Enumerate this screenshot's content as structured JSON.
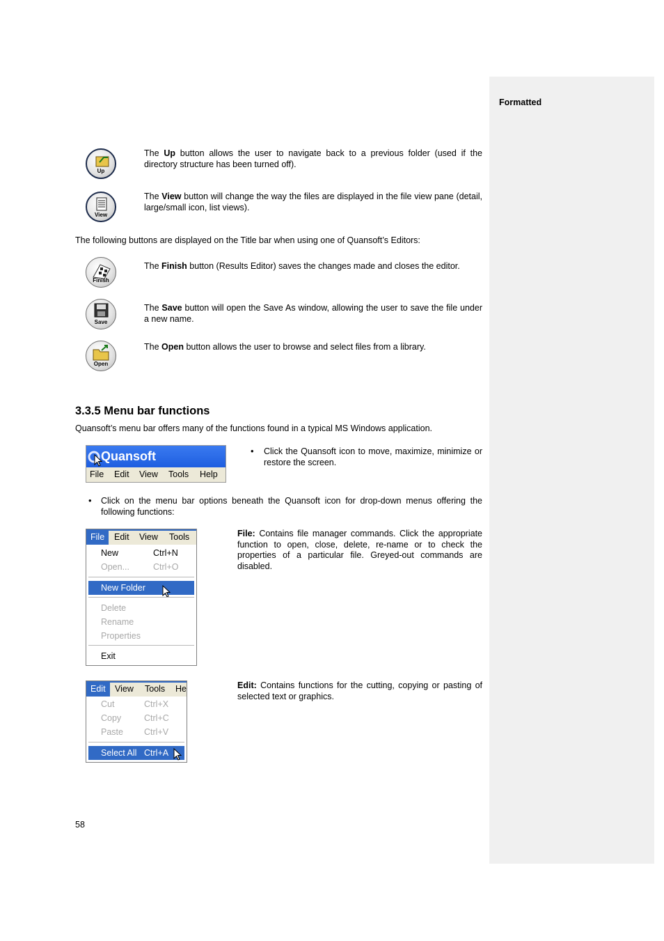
{
  "comment_pane": {
    "label": "Formatted"
  },
  "icons": {
    "up": "Up",
    "view": "View",
    "finish": "Finish",
    "save": "Save",
    "open": "Open"
  },
  "paragraphs": {
    "up": {
      "pre": "The ",
      "bold": "Up",
      "post": " button allows the user to navigate back to a previous folder (used if the directory structure has been turned off)."
    },
    "view": {
      "pre": "The ",
      "bold": "View",
      "post": " button will change the way the files are displayed in the file view pane (detail, large/small icon, list views)."
    },
    "title_bar_intro": "The following buttons are displayed on the Title bar when using one of Quansoft’s Editors:",
    "finish": {
      "pre": "The ",
      "bold": "Finish",
      "post": " button (Results Editor) saves the changes made and closes the editor."
    },
    "save": {
      "pre": "The ",
      "bold": "Save",
      "post": " button will open the Save As window, allowing the user to save the file under a new name."
    },
    "open": {
      "pre": "The ",
      "bold": "Open",
      "post": " button allows the user to browse and select files from a library."
    }
  },
  "section": {
    "heading": "3.3.5  Menu bar functions",
    "intro": "Quansoft’s menu bar offers many of the functions found in a typical MS Windows application.",
    "bullet_icon": "Click the Quansoft icon to move, maximize, minimize or restore the screen.",
    "bullet_menu": "Click on the menu bar options beneath the Quansoft icon for drop-down menus offering the following functions:",
    "file_desc": {
      "bold": "File:",
      "post": " Contains file manager commands. Click the appropriate function to open, close, delete, re-name or to check the properties of a particular file. Greyed-out commands are disabled."
    },
    "edit_desc": {
      "bold": "Edit:",
      "post": " Contains functions for the cutting, copying or pasting of selected text or graphics."
    }
  },
  "bullet_char": "•",
  "quansoft_window": {
    "title": "Quansoft",
    "menu": [
      "File",
      "Edit",
      "View",
      "Tools",
      "Help"
    ]
  },
  "file_menu": {
    "headers": [
      "File",
      "Edit",
      "View",
      "Tools"
    ],
    "items": [
      {
        "label": "New",
        "shortcut": "Ctrl+N",
        "state": "enabled"
      },
      {
        "label": "Open...",
        "shortcut": "Ctrl+O",
        "state": "disabled"
      },
      {
        "label": "New Folder",
        "shortcut": "",
        "state": "selected"
      },
      {
        "label": "Delete",
        "shortcut": "",
        "state": "disabled"
      },
      {
        "label": "Rename",
        "shortcut": "",
        "state": "disabled"
      },
      {
        "label": "Properties",
        "shortcut": "",
        "state": "disabled"
      },
      {
        "label": "Exit",
        "shortcut": "",
        "state": "enabled"
      }
    ]
  },
  "edit_menu": {
    "headers": [
      "Edit",
      "View",
      "Tools",
      "He"
    ],
    "items": [
      {
        "label": "Cut",
        "shortcut": "Ctrl+X",
        "state": "disabled"
      },
      {
        "label": "Copy",
        "shortcut": "Ctrl+C",
        "state": "disabled"
      },
      {
        "label": "Paste",
        "shortcut": "Ctrl+V",
        "state": "disabled"
      },
      {
        "label": "Select All",
        "shortcut": "Ctrl+A",
        "state": "selected"
      }
    ]
  },
  "page_number": "58",
  "colors": {
    "selection": "#316ac5",
    "titlebar": "#2a6ae8",
    "menubar": "#ece9d8",
    "disabled": "#a8a8a8"
  }
}
